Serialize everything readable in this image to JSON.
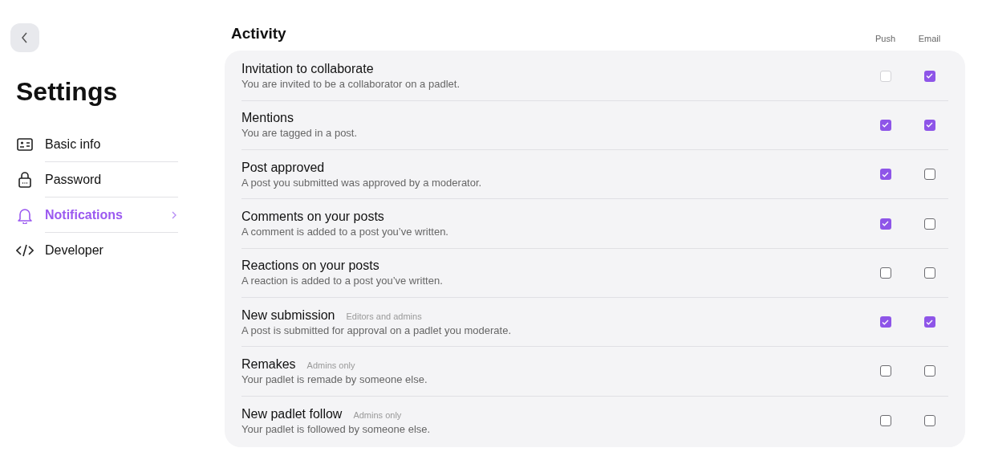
{
  "sidebar": {
    "title": "Settings",
    "items": [
      {
        "label": "Basic info",
        "kind": "profile",
        "selected": false
      },
      {
        "label": "Password",
        "kind": "security",
        "selected": false
      },
      {
        "label": "Notifications",
        "kind": "alerts",
        "selected": true
      },
      {
        "label": "Developer",
        "kind": "developer",
        "selected": false
      }
    ]
  },
  "section": {
    "title": "Activity",
    "columns": [
      "Push",
      "Email"
    ],
    "rows": [
      {
        "title": "Invitation to collaborate",
        "description": "You are invited to be a collaborator on a padlet.",
        "push": {
          "checked": false,
          "disabled": true
        },
        "email": {
          "checked": true,
          "disabled": false
        }
      },
      {
        "title": "Mentions",
        "description": "You are tagged in a post.",
        "push": {
          "checked": true,
          "disabled": false
        },
        "email": {
          "checked": true,
          "disabled": false
        }
      },
      {
        "title": "Post approved",
        "description": "A post you submitted was approved by a moderator.",
        "push": {
          "checked": true,
          "disabled": false
        },
        "email": {
          "checked": false,
          "disabled": false
        }
      },
      {
        "title": "Comments on your posts",
        "description": "A comment is added to a post you’ve written.",
        "push": {
          "checked": true,
          "disabled": false
        },
        "email": {
          "checked": false,
          "disabled": false
        }
      },
      {
        "title": "Reactions on your posts",
        "description": "A reaction is added to a post you’ve written.",
        "push": {
          "checked": false,
          "disabled": false
        },
        "email": {
          "checked": false,
          "disabled": false
        }
      },
      {
        "title": "New submission",
        "tag": "Editors and admins",
        "description": "A post is submitted for approval on a padlet you moderate.",
        "push": {
          "checked": true,
          "disabled": false
        },
        "email": {
          "checked": true,
          "disabled": false
        }
      },
      {
        "title": "Remakes",
        "tag": "Admins only",
        "description": "Your padlet is remade by someone else.",
        "push": {
          "checked": false,
          "disabled": false
        },
        "email": {
          "checked": false,
          "disabled": false
        }
      },
      {
        "title": "New padlet follow",
        "tag": "Admins only",
        "description": "Your padlet is followed by someone else.",
        "push": {
          "checked": false,
          "disabled": false
        },
        "email": {
          "checked": false,
          "disabled": false
        }
      }
    ]
  }
}
